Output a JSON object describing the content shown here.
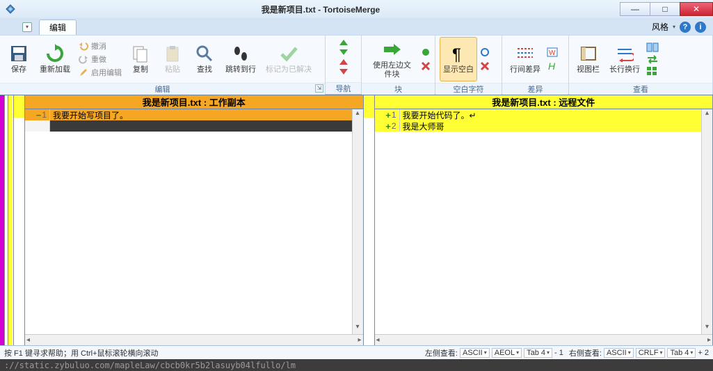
{
  "title": "我是新项目.txt - TortoiseMerge",
  "tab_edit": "编辑",
  "style_label": "风格",
  "ribbon": {
    "save": "保存",
    "reload": "重新加载",
    "undo": "撤消",
    "redo": "重做",
    "enable_edit": "启用编辑",
    "copy": "复制",
    "paste": "粘贴",
    "find": "查找",
    "goto": "跳转到行",
    "mark_resolved": "标记为已解决",
    "use_left_block": "使用左边文件块",
    "show_ws": "显示空白",
    "inline_diff": "行间差异",
    "view_bar": "视图栏",
    "wrap": "长行换行",
    "group_edit": "编辑",
    "group_nav": "导航",
    "group_block": "块",
    "group_ws": "空白字符",
    "group_diff": "差异",
    "group_view": "查看"
  },
  "left": {
    "title": "我是新项目.txt : 工作副本",
    "line1_no": "1",
    "line1_text": "我要开始写项目了。"
  },
  "right": {
    "title": "我是新项目.txt : 远程文件",
    "line1_no": "1",
    "line1_text": "我要开始代码了。↵",
    "line2_no": "2",
    "line2_text": "我是大师哥"
  },
  "status": {
    "help": "按 F1 键寻求帮助；用 Ctrl+鼠标滚轮横向滚动",
    "left_label": "左侧查看:",
    "right_label": "右侧查看:",
    "ascii": "ASCII",
    "aeol": "AEOL",
    "crlf": "CRLF",
    "tab4": "Tab 4",
    "minus1": "- 1",
    "plus2": "+ 2"
  },
  "garbage": "://static.zybuluo.com/mapleLaw/cbcb0kr5b2lasuyb04lfullo/lm"
}
